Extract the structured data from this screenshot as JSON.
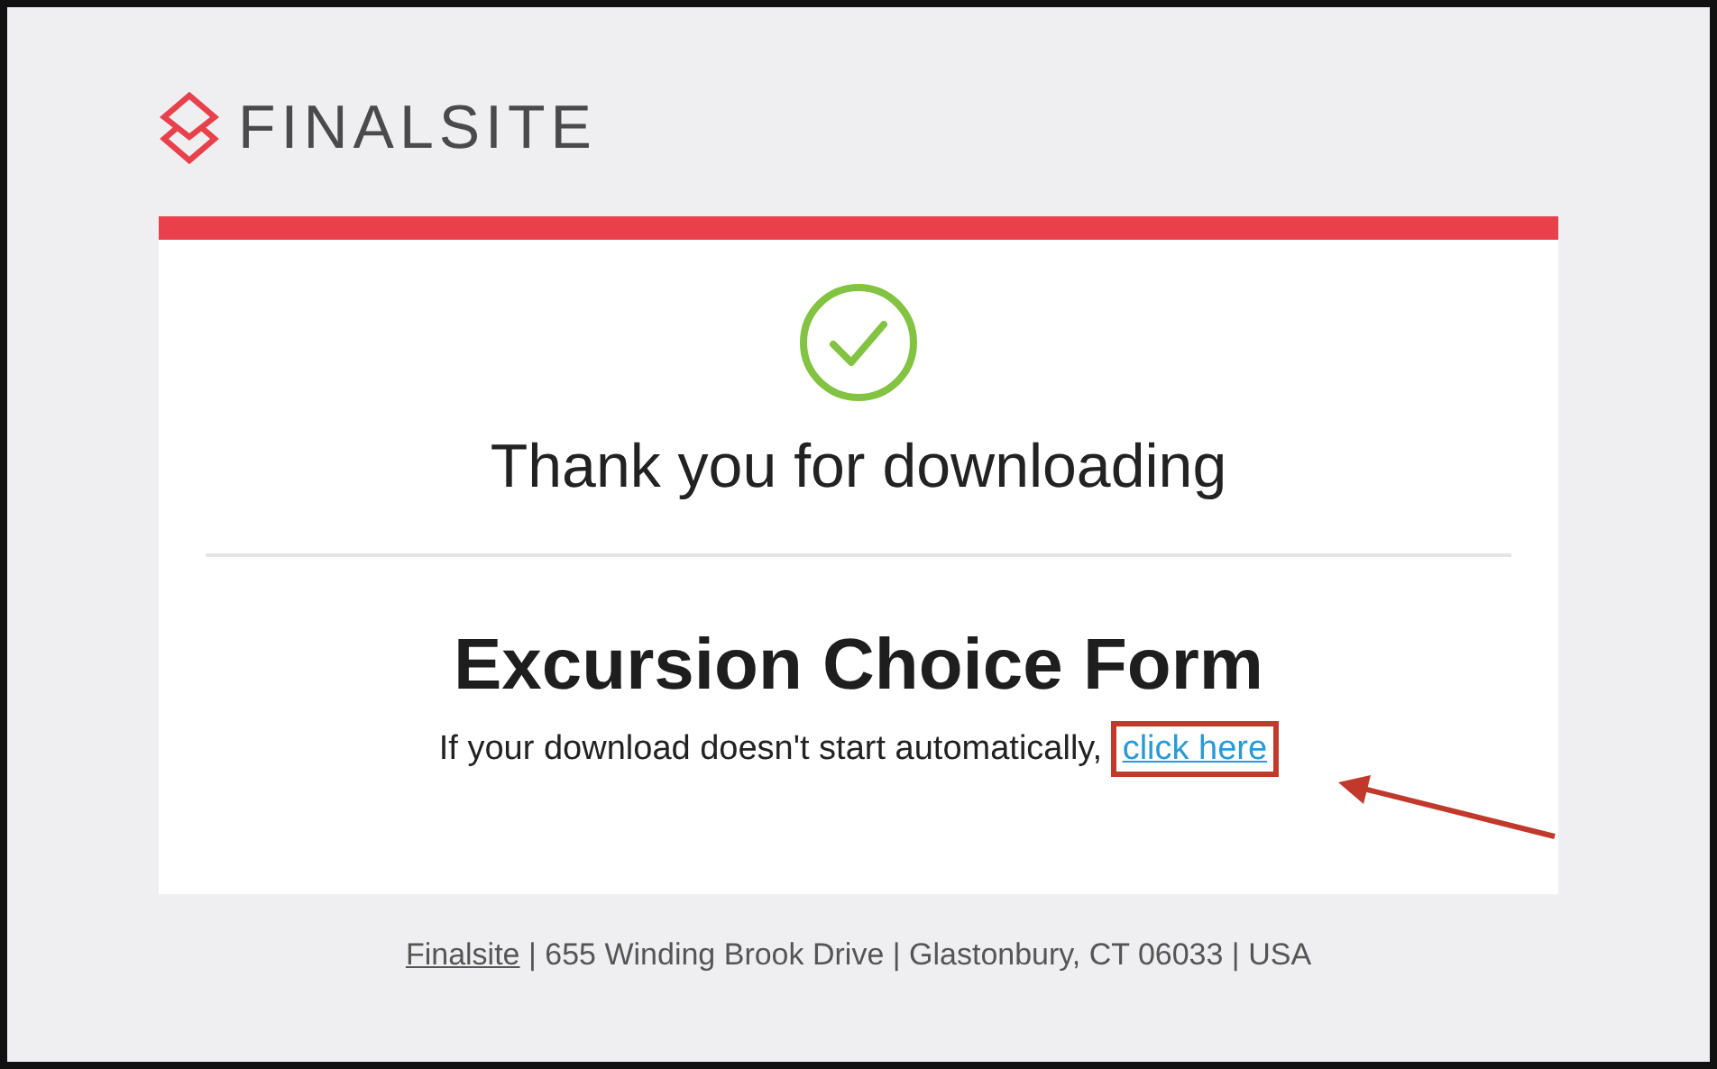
{
  "logo": {
    "wordmark": "FINALSITE"
  },
  "confirmation": {
    "title": "Thank you for downloading",
    "file_name": "Excursion Choice Form",
    "message": "If your download doesn't start automatically,",
    "link": {
      "text": "click here",
      "highlighted": true
    }
  },
  "footer": {
    "link": "Finalsite",
    "address": " | 655 Winding Brook Drive | Glastonbury, CT 06033 | USA"
  }
}
